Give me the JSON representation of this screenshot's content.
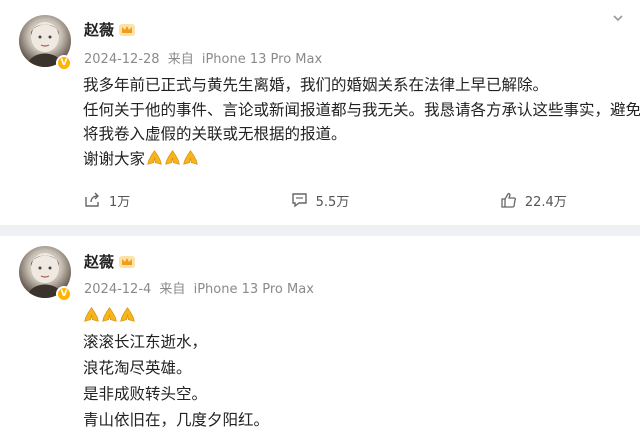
{
  "posts": [
    {
      "author": "赵薇",
      "timestamp": "2024-12-28",
      "source_prefix": "来自",
      "device": "iPhone 13 Pro Max",
      "lines": [
        "我多年前已正式与黄先生离婚，我们的婚姻关系在法律上早已解除。",
        "任何关于他的事件、言论或新闻报道都与我无关。我恳请各方承认这些事实，避免",
        "将我卷入虚假的关联或无根据的报道。",
        "谢谢大家"
      ],
      "emoji": [
        "praying-hands-icon",
        "praying-hands-icon",
        "praying-hands-icon"
      ],
      "actions": {
        "share_count": "1万",
        "comment_count": "5.5万",
        "like_count": "22.4万"
      }
    },
    {
      "author": "赵薇",
      "timestamp": "2024-12-4",
      "source_prefix": "来自",
      "device": "iPhone 13 Pro Max",
      "emoji": [
        "praying-hands-icon",
        "praying-hands-icon",
        "praying-hands-icon"
      ],
      "lines": [
        "滚滚长江东逝水，",
        "浪花淘尽英雄。",
        "是非成败转头空。",
        "青山依旧在，几度夕阳红。"
      ]
    }
  ],
  "colors": {
    "page_bg": "#eef0f3",
    "card_bg": "#ffffff",
    "meta_text": "#8a8a8a",
    "verified_badge": "#ffb400",
    "emoji": "#f5b51b"
  }
}
